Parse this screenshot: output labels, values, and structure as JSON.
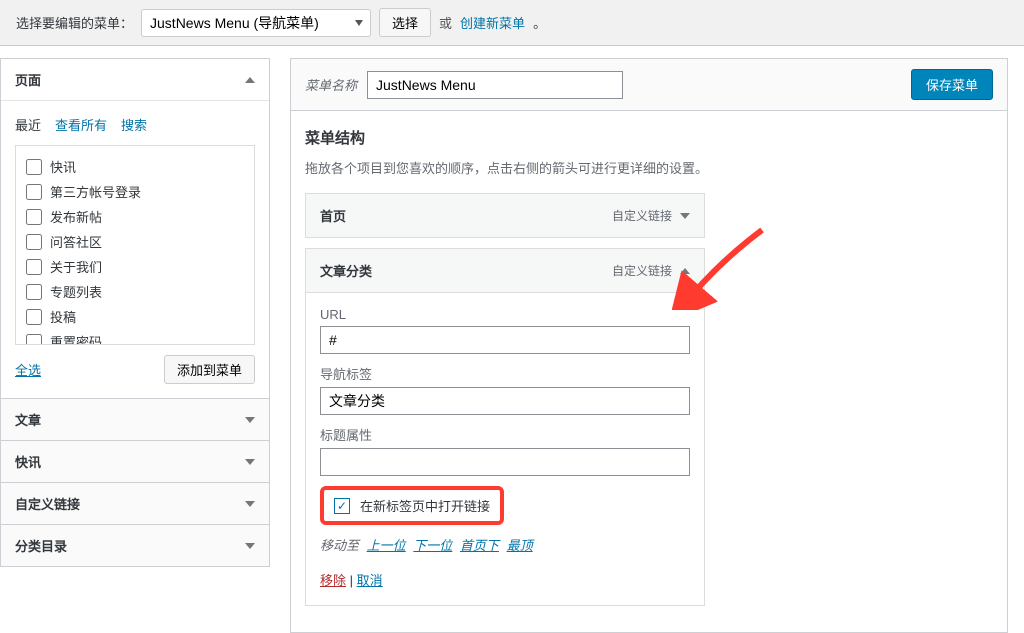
{
  "topbar": {
    "label": "选择要编辑的菜单：",
    "selectedMenu": "JustNews Menu (导航菜单)",
    "selectBtn": "选择",
    "or": "或",
    "createLink": "创建新菜单",
    "period": "。"
  },
  "sidebar": {
    "panels": [
      {
        "title": "页面",
        "open": true
      },
      {
        "title": "文章",
        "open": false
      },
      {
        "title": "快讯",
        "open": false
      },
      {
        "title": "自定义链接",
        "open": false
      },
      {
        "title": "分类目录",
        "open": false
      }
    ],
    "tabs": {
      "recent": "最近",
      "viewAll": "查看所有",
      "search": "搜索"
    },
    "pages": [
      "快讯",
      "第三方帐号登录",
      "发布新帖",
      "问答社区",
      "关于我们",
      "专题列表",
      "投稿",
      "重置密码"
    ],
    "selectAll": "全选",
    "addToMenu": "添加到菜单"
  },
  "content": {
    "nameLabel": "菜单名称",
    "nameValue": "JustNews Menu",
    "saveBtn": "保存菜单",
    "structure": {
      "title": "菜单结构",
      "desc": "拖放各个项目到您喜欢的顺序，点击右侧的箭头可进行更详细的设置。"
    },
    "menuItems": {
      "home": {
        "title": "首页",
        "type": "自定义链接"
      },
      "category": {
        "title": "文章分类",
        "type": "自定义链接",
        "urlLabel": "URL",
        "urlValue": "#",
        "navLabel": "导航标签",
        "navValue": "文章分类",
        "titleAttrLabel": "标题属性",
        "titleAttrValue": "",
        "openNewTab": "在新标签页中打开链接",
        "moveTo": "移动至",
        "moveUp": "上一位",
        "moveDown": "下一位",
        "moveUnder": "首页下",
        "moveTop": "最顶",
        "remove": "移除",
        "cancel": "取消"
      }
    }
  }
}
